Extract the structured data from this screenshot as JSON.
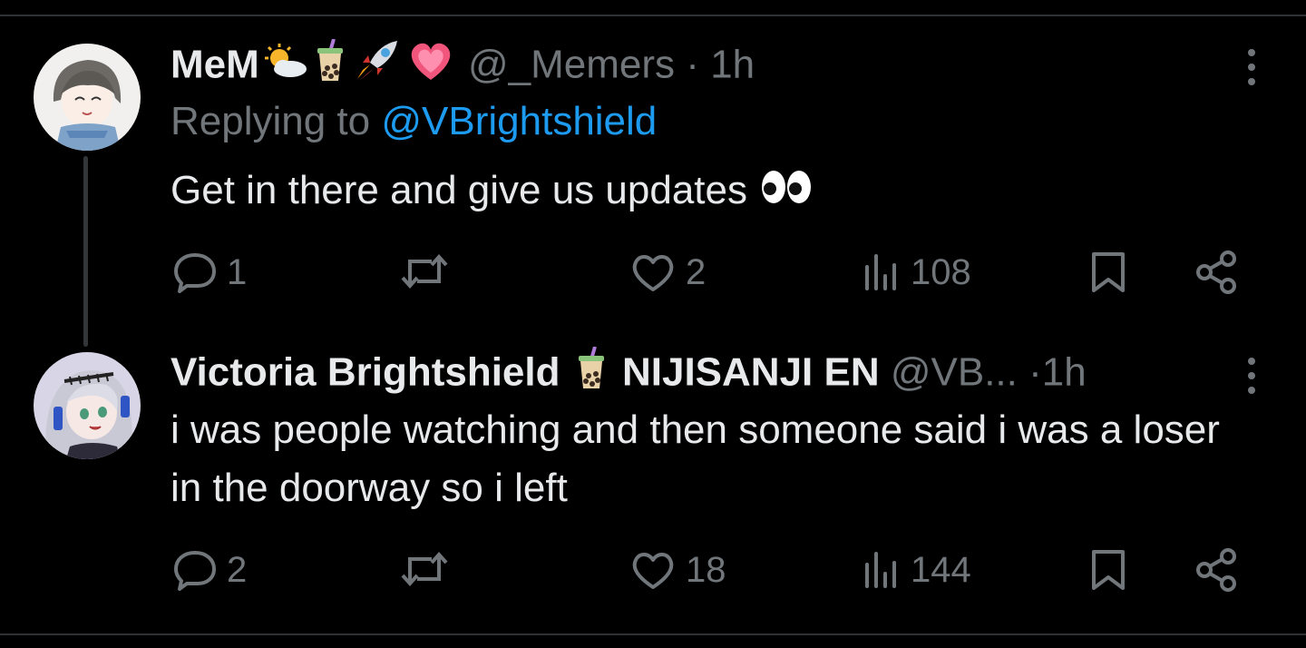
{
  "tweets": [
    {
      "display_name": "MeM",
      "name_emojis": [
        "sun-behind-cloud-emoji",
        "bubble-tea-emoji",
        "rocket-emoji",
        "sparkling-heart-emoji"
      ],
      "handle": "@_Memers",
      "separator": "·",
      "time": "1h",
      "replying_label": "Replying to ",
      "replying_to": "@VBrightshield",
      "text": "Get in there and give us updates",
      "text_emoji": "eyes-emoji",
      "counts": {
        "replies": "1",
        "reposts": "",
        "likes": "2",
        "views": "108"
      }
    },
    {
      "display_name": "Victoria Brightshield",
      "name_emojis": [
        "bubble-tea-emoji"
      ],
      "name_suffix": "NIJISANJI EN",
      "handle": "@VB...",
      "separator": "·",
      "time": "1h",
      "text": "i was people watching and then someone said i was a loser in the doorway so i left",
      "counts": {
        "replies": "2",
        "reposts": "",
        "likes": "18",
        "views": "144"
      }
    }
  ],
  "colors": {
    "background": "#000000",
    "text": "#e7e9ea",
    "muted": "#71767b",
    "link": "#1d9bf0",
    "divider": "#2f3336"
  }
}
